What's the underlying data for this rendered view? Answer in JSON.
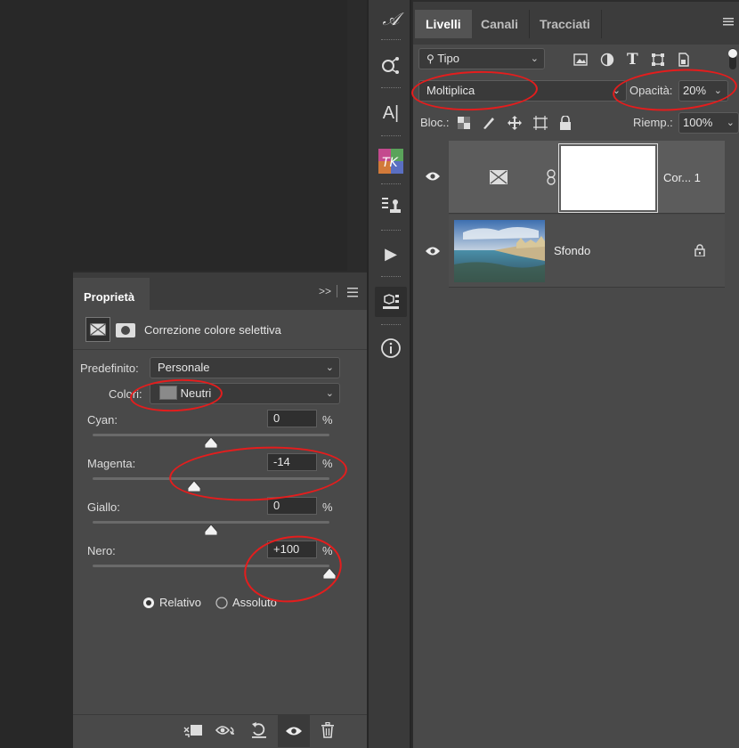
{
  "layers_panel": {
    "tabs": [
      {
        "label": "Livelli",
        "active": true
      },
      {
        "label": "Canali",
        "active": false
      },
      {
        "label": "Tracciati",
        "active": false
      }
    ],
    "filter_label": "Tipo",
    "blend_mode": "Moltiplica",
    "opacity_label": "Opacità:",
    "opacity_value": "20%",
    "lock_label": "Bloc.:",
    "fill_label": "Riemp.:",
    "fill_value": "100%",
    "layers": [
      {
        "name": "Cor... 1",
        "kind": "adjustment",
        "visible": true
      },
      {
        "name": "Sfondo",
        "kind": "image",
        "visible": true,
        "locked": true
      }
    ]
  },
  "properties_panel": {
    "title": "Proprietà",
    "subtitle": "Correzione colore selettiva",
    "preset_label": "Predefinito:",
    "preset_value": "Personale",
    "colors_label": "Colori:",
    "colors_value": "Neutri",
    "sliders": [
      {
        "label": "Cyan:",
        "value": "0",
        "pct": "%",
        "level": 0
      },
      {
        "label": "Magenta:",
        "value": "-14",
        "pct": "%",
        "level": -14
      },
      {
        "label": "Giallo:",
        "value": "0",
        "pct": "%",
        "level": 0
      },
      {
        "label": "Nero:",
        "value": "+100",
        "pct": "%",
        "level": 100
      }
    ],
    "method_relative": "Relativo",
    "method_absolute": "Assoluto",
    "method_selected": "Relativo"
  },
  "toolstrip": {
    "tools": [
      "character-style-icon",
      "share-icon",
      "paragraph-icon",
      "tk-plugin-icon",
      "stamp-icon",
      "play-icon",
      "3d-icon",
      "info-icon"
    ]
  },
  "colors": {
    "annotation": "#e41d1d",
    "panel": "#494949",
    "header": "#3c3c3c"
  }
}
